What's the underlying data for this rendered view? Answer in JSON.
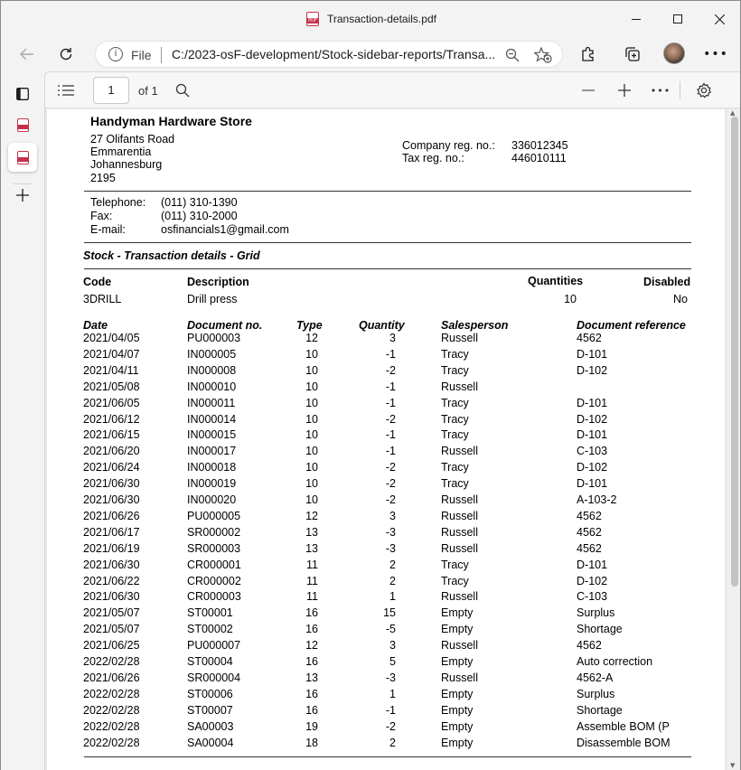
{
  "window": {
    "title": "Transaction-details.pdf"
  },
  "address": {
    "scheme_label": "File",
    "url": "C:/2023-osF-development/Stock-sidebar-reports/Transa..."
  },
  "pdf_toolbar": {
    "page_current": "1",
    "page_total": "of 1"
  },
  "company": {
    "name": "Handyman Hardware Store",
    "address_lines": [
      "27 Olifants Road",
      "Emmarentia",
      "Johannesburg",
      "2195"
    ],
    "reg_label": "Company reg. no.:",
    "reg_value": "336012345",
    "tax_label": "Tax reg. no.:",
    "tax_value": "446010111",
    "tel_label": "Telephone:",
    "tel_value": "(011) 310-1390",
    "fax_label": "Fax:",
    "fax_value": "(011) 310-2000",
    "email_label": "E-mail:",
    "email_value": "osfinancials1@gmail.com"
  },
  "report": {
    "title": "Stock - Transaction details - Grid",
    "item_headers": {
      "code": "Code",
      "description": "Description",
      "quantities": "Quantities",
      "disabled": "Disabled"
    },
    "item": {
      "code": "3DRILL",
      "description": "Drill press",
      "quantities": "10",
      "disabled": "No"
    },
    "columns": [
      "Date",
      "Document no.",
      "Type",
      "Quantity",
      "Salesperson",
      "Document reference"
    ],
    "rows": [
      [
        "2021/04/05",
        "PU000003",
        "12",
        "3",
        "Russell",
        "4562"
      ],
      [
        "2021/04/07",
        "IN000005",
        "10",
        "-1",
        "Tracy",
        "D-101"
      ],
      [
        "2021/04/11",
        "IN000008",
        "10",
        "-2",
        "Tracy",
        "D-102"
      ],
      [
        "2021/05/08",
        "IN000010",
        "10",
        "-1",
        "Russell",
        ""
      ],
      [
        "2021/06/05",
        "IN000011",
        "10",
        "-1",
        "Tracy",
        "D-101"
      ],
      [
        "2021/06/12",
        "IN000014",
        "10",
        "-2",
        "Tracy",
        "D-102"
      ],
      [
        "2021/06/15",
        "IN000015",
        "10",
        "-1",
        "Tracy",
        "D-101"
      ],
      [
        "2021/06/20",
        "IN000017",
        "10",
        "-1",
        "Russell",
        "C-103"
      ],
      [
        "2021/06/24",
        "IN000018",
        "10",
        "-2",
        "Tracy",
        "D-102"
      ],
      [
        "2021/06/30",
        "IN000019",
        "10",
        "-2",
        "Tracy",
        "D-101"
      ],
      [
        "2021/06/30",
        "IN000020",
        "10",
        "-2",
        "Russell",
        "A-103-2"
      ],
      [
        "2021/06/26",
        "PU000005",
        "12",
        "3",
        "Russell",
        "4562"
      ],
      [
        "2021/06/17",
        "SR000002",
        "13",
        "-3",
        "Russell",
        "4562"
      ],
      [
        "2021/06/19",
        "SR000003",
        "13",
        "-3",
        "Russell",
        "4562"
      ],
      [
        "2021/06/30",
        "CR000001",
        "11",
        "2",
        "Tracy",
        "D-101"
      ],
      [
        "2021/06/22",
        "CR000002",
        "11",
        "2",
        "Tracy",
        "D-102"
      ],
      [
        "2021/06/30",
        "CR000003",
        "11",
        "1",
        "Russell",
        "C-103"
      ],
      [
        "2021/05/07",
        "ST00001",
        "16",
        "15",
        "Empty",
        "Surplus"
      ],
      [
        "2021/05/07",
        "ST00002",
        "16",
        "-5",
        "Empty",
        "Shortage"
      ],
      [
        "2021/06/25",
        "PU000007",
        "12",
        "3",
        "Russell",
        "4562"
      ],
      [
        "2022/02/28",
        "ST00004",
        "16",
        "5",
        "Empty",
        "Auto correction"
      ],
      [
        "2021/06/26",
        "SR000004",
        "13",
        "-3",
        "Russell",
        "4562-A"
      ],
      [
        "2022/02/28",
        "ST00006",
        "16",
        "1",
        "Empty",
        "Surplus"
      ],
      [
        "2022/02/28",
        "ST00007",
        "16",
        "-1",
        "Empty",
        "Shortage"
      ],
      [
        "2022/02/28",
        "SA00003",
        "19",
        "-2",
        "Empty",
        "Assemble BOM (P"
      ],
      [
        "2022/02/28",
        "SA00004",
        "18",
        "2",
        "Empty",
        "Disassemble BOM"
      ]
    ]
  },
  "colors": {
    "accent_pdf": "#c4314b",
    "cursor": "#e81123"
  },
  "icons": [
    "pdf-icon",
    "minimize-icon",
    "maximize-icon",
    "close-icon",
    "back-icon",
    "refresh-icon",
    "info-icon",
    "zoom-icon",
    "favorite-add-icon",
    "extensions-icon",
    "collections-icon",
    "more-icon",
    "contents-icon",
    "search-icon",
    "zoom-out-icon",
    "zoom-in-icon",
    "settings-icon",
    "tab-actions-icon",
    "new-tab-icon"
  ]
}
